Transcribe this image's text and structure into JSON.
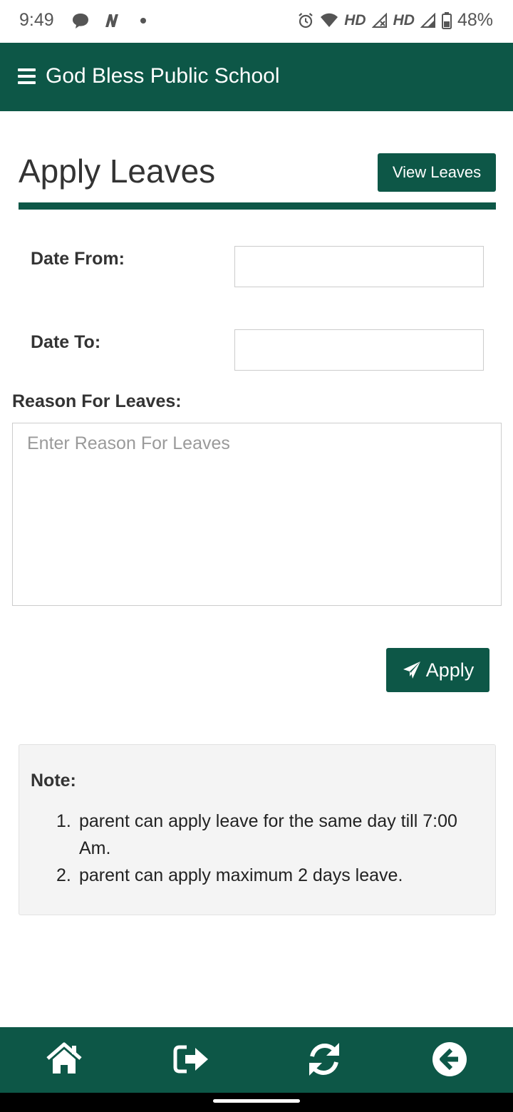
{
  "status_bar": {
    "time": "9:49",
    "network_label_1": "HD",
    "network_label_2": "HD",
    "battery": "48%",
    "icons": [
      "chat-bubble-icon",
      "n-app-icon",
      "dot-icon",
      "alarm-icon",
      "wifi-icon",
      "signal-x-icon",
      "signal-icon",
      "battery-icon"
    ]
  },
  "app_bar": {
    "title": "God Bless Public School",
    "menu_icon": "hamburger-menu-icon"
  },
  "page": {
    "title": "Apply Leaves",
    "view_leaves_label": "View Leaves"
  },
  "form": {
    "date_from_label": "Date From:",
    "date_from_value": "",
    "date_to_label": "Date To:",
    "date_to_value": "",
    "reason_label": "Reason For Leaves:",
    "reason_placeholder": "Enter Reason For Leaves",
    "reason_value": "",
    "apply_label": "Apply",
    "apply_icon": "paper-plane-icon"
  },
  "note": {
    "title": "Note:",
    "items": [
      {
        "num": "1.",
        "text": "parent can apply leave for the same day till 7:00 Am."
      },
      {
        "num": "2.",
        "text": "parent can apply maximum 2 days leave."
      }
    ]
  },
  "bottom_nav": {
    "items": [
      "home-icon",
      "sign-out-icon",
      "refresh-icon",
      "back-arrow-icon"
    ]
  },
  "colors": {
    "brand": "#0d5747",
    "note_background": "#f4f4f4"
  }
}
